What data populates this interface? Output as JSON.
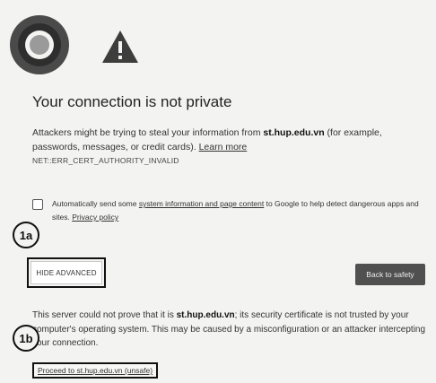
{
  "page": {
    "title": "Your connection is not private",
    "intro_before": "Attackers might be trying to steal your information from ",
    "domain": "st.hup.edu.vn",
    "intro_after": " (for example, passwords, messages, or credit cards). ",
    "learn_more": "Learn more",
    "error_code": "NET::ERR_CERT_AUTHORITY_INVALID"
  },
  "optin": {
    "text_before": "Automatically send some ",
    "link": "system information and page content",
    "text_after": " to Google to help detect dangerous apps and sites. ",
    "privacy_link": "Privacy policy",
    "checked": false
  },
  "annotations": {
    "a": "1a",
    "b": "1b"
  },
  "buttons": {
    "hide_advanced": "HIDE ADVANCED",
    "back_to_safety": "Back to safety"
  },
  "details": {
    "before": "This server could not prove that it is ",
    "domain": "st.hup.edu.vn",
    "after": "; its security certificate is not trusted by your computer's operating system. This may be caused by a misconfiguration or an attacker intercepting your connection."
  },
  "proceed": {
    "label": "Proceed to st.hup.edu.vn (unsafe)"
  },
  "colors": {
    "background": "#f3f3f1",
    "button_dark": "#505050",
    "warning_icon": "#3d3d3d",
    "logo_ring": "#4a4a4a"
  },
  "icons": {
    "logo": "chrome-logo-icon",
    "warning": "warning-triangle-icon",
    "checkbox": "checkbox-icon"
  }
}
